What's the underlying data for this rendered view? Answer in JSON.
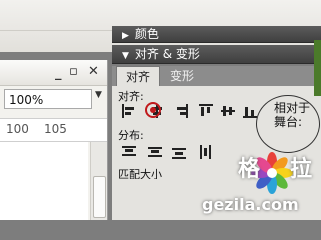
{
  "panels": {
    "color": {
      "title": "颜色"
    },
    "align": {
      "title": "对齐 & 变形",
      "tabs": [
        {
          "label": "对齐"
        },
        {
          "label": "变形"
        }
      ],
      "align_label": "对齐:",
      "distribute_label": "分布:",
      "match_size_label": "匹配大小",
      "relative_label_line1": "相对于",
      "relative_label_line2": "舞台:"
    }
  },
  "document": {
    "zoom_value": "100%",
    "ruler_ticks": [
      "100",
      "105"
    ]
  },
  "icons": {
    "minimize": "minimize-icon",
    "restore": "restore-icon",
    "close": "close-icon",
    "collapse": "triangle-right-icon",
    "expand": "triangle-down-icon"
  },
  "watermark": {
    "word": "格",
    "word_tail": "拉",
    "url": "gezila.com"
  },
  "colors": {
    "panel_header": "#4a4a4a",
    "panel_body": "#e4e3df",
    "annotation_red": "#c0191c"
  }
}
